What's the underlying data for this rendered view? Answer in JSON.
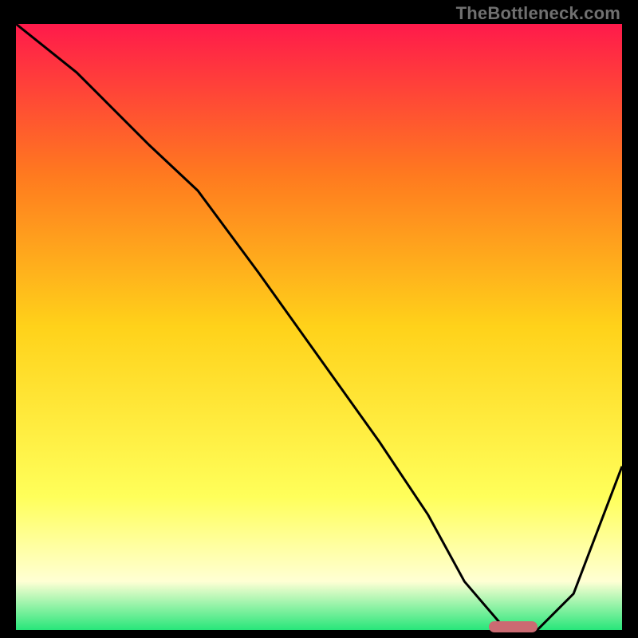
{
  "watermark": "TheBottleneck.com",
  "colors": {
    "top": "#ff1a4b",
    "mid_upper": "#ff7a1f",
    "mid": "#ffd21a",
    "mid_lower": "#ffff5a",
    "pale": "#ffffd4",
    "bottom": "#27e67a",
    "curve": "#000000",
    "marker": "#cb6a72",
    "background": "#000000"
  },
  "chart_data": {
    "type": "line",
    "title": "",
    "xlabel": "",
    "ylabel": "",
    "xlim": [
      0,
      100
    ],
    "ylim": [
      0,
      100
    ],
    "grid": false,
    "series": [
      {
        "name": "bottleneck-curve",
        "x": [
          0,
          10,
          22,
          30,
          40,
          50,
          60,
          68,
          74,
          80,
          86,
          92,
          100
        ],
        "values": [
          100,
          92,
          80,
          72.5,
          59,
          45,
          31,
          19,
          8,
          1,
          0,
          6,
          27
        ]
      }
    ],
    "annotations": [
      {
        "name": "optimal-marker",
        "x_start": 78,
        "x_end": 86,
        "y": 0.5
      }
    ]
  }
}
